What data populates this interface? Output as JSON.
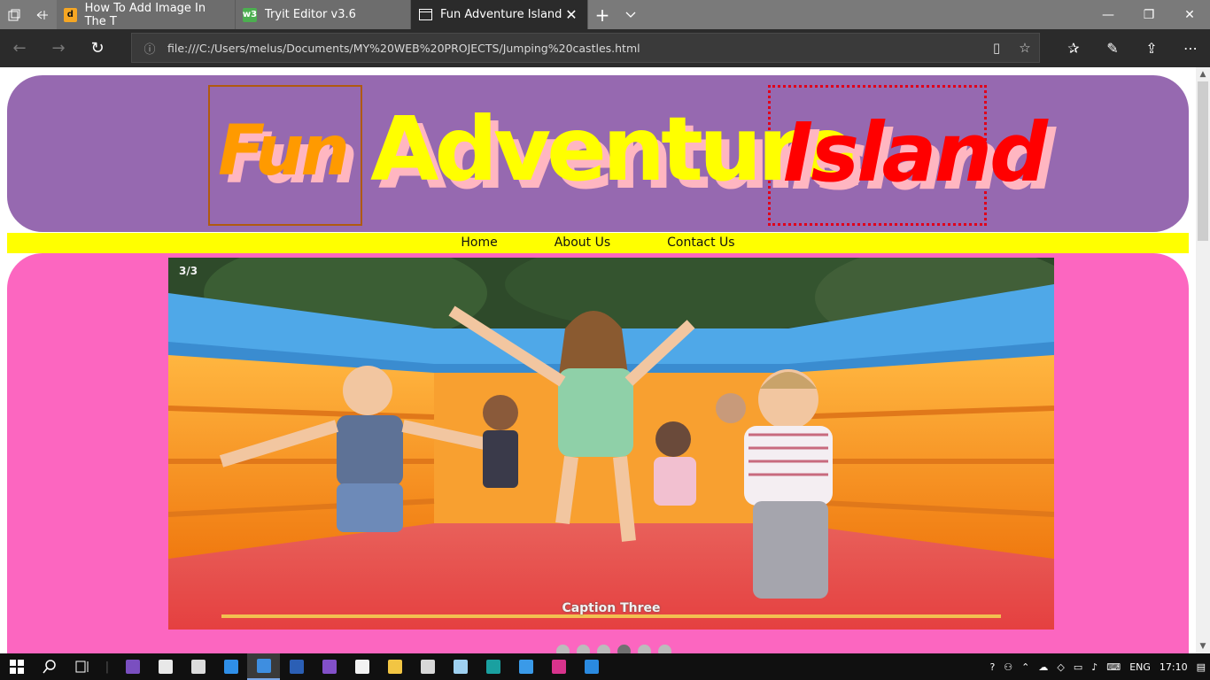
{
  "browser": {
    "tabs": [
      {
        "title": "How To Add Image In The T",
        "favicon": "d",
        "favicon_color": "#f5a623",
        "active": false
      },
      {
        "title": "Tryit Editor v3.6",
        "favicon": "w3",
        "favicon_color": "#4caf50",
        "active": false
      },
      {
        "title": "Fun Adventure Island",
        "favicon": "page-icon",
        "active": true
      }
    ],
    "url": "file:///C:/Users/melus/Documents/MY%20WEB%20PROJECTS/Jumping%20castles.html"
  },
  "header": {
    "word1": "Fun",
    "word2": "Adventure",
    "word3": "Island",
    "colors": {
      "background": "#9669b0",
      "fun": "#ff9a00",
      "adventure": "#ffff00",
      "island": "#ff0000",
      "shadow": "#ffb6c1"
    }
  },
  "menu": {
    "items": [
      "Home",
      "About Us",
      "Contact Us"
    ],
    "background": "#ffff00"
  },
  "slideshow": {
    "counter": "3/3",
    "caption": "Caption Three",
    "dot_count": 6,
    "active_dot": 3,
    "background": "#fc66c0"
  },
  "taskbar": {
    "clock": "17:10",
    "language": "ENG"
  }
}
